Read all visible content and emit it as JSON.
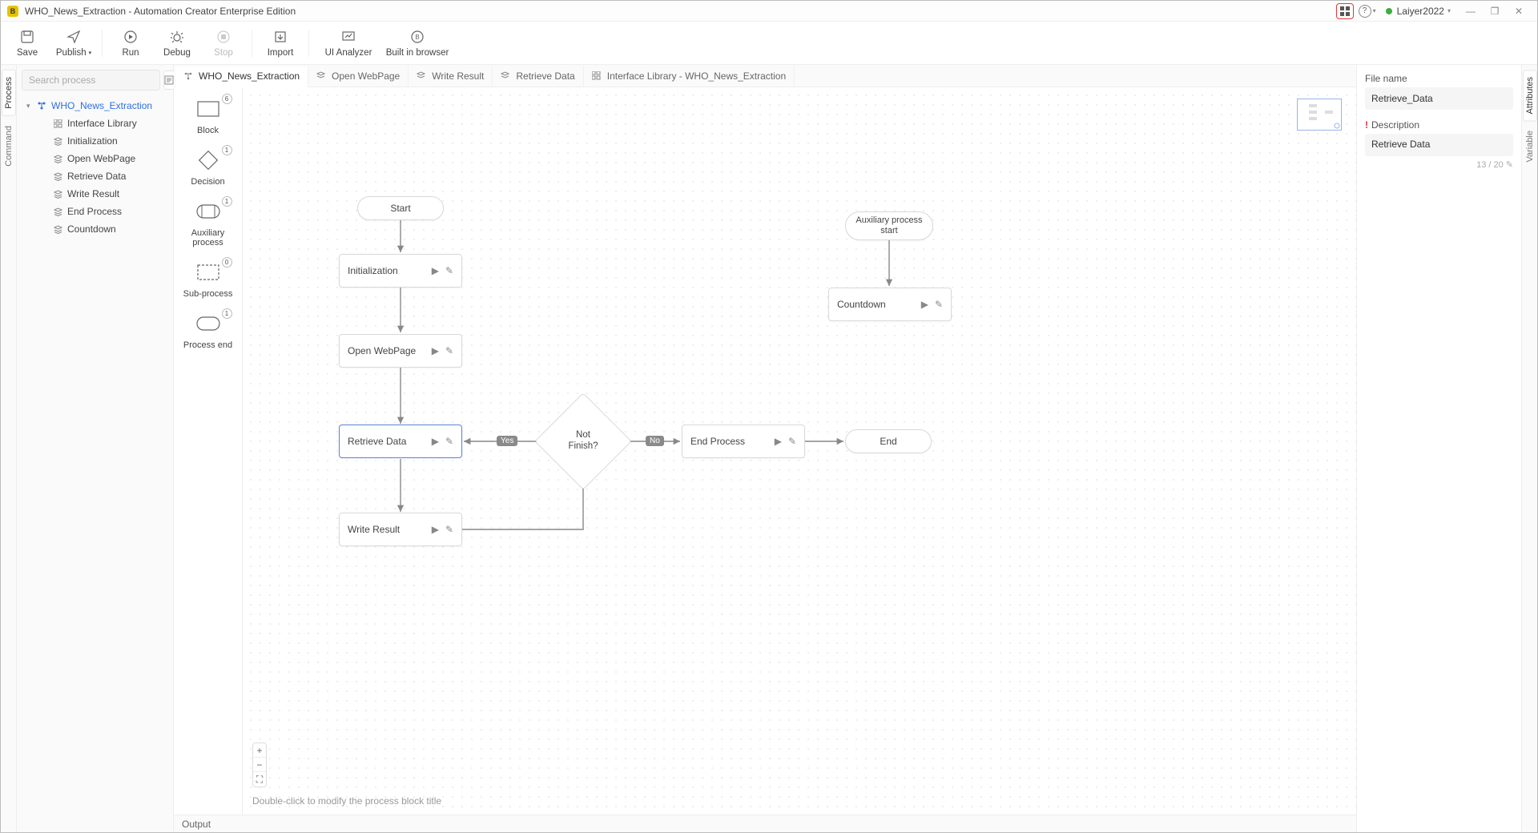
{
  "titlebar": {
    "app_icon_letter": "B",
    "title": "WHO_News_Extraction - Automation Creator Enterprise Edition",
    "user": "Laiyer2022"
  },
  "toolbar": {
    "save": "Save",
    "publish": "Publish",
    "run": "Run",
    "debug": "Debug",
    "stop": "Stop",
    "import": "Import",
    "ui_analyzer": "UI Analyzer",
    "built_in_browser": "Built in browser"
  },
  "side_tabs": {
    "process": "Process",
    "command": "Command"
  },
  "right_tabs": {
    "attributes": "Attributes",
    "variable": "Variable"
  },
  "search": {
    "placeholder": "Search process"
  },
  "tree": {
    "root": "WHO_News_Extraction",
    "children": [
      "Interface Library",
      "Initialization",
      "Open WebPage",
      "Retrieve Data",
      "Write Result",
      "End Process",
      "Countdown"
    ]
  },
  "palette": {
    "block": {
      "label": "Block",
      "badge": "6"
    },
    "decision": {
      "label": "Decision",
      "badge": "1"
    },
    "aux": {
      "label": "Auxiliary process",
      "badge": "1"
    },
    "sub": {
      "label": "Sub-process",
      "badge": "0"
    },
    "end": {
      "label": "Process end",
      "badge": "1"
    }
  },
  "tabs": [
    {
      "label": "WHO_News_Extraction",
      "icon": "flow",
      "active": true
    },
    {
      "label": "Open WebPage",
      "icon": "layers"
    },
    {
      "label": "Write Result",
      "icon": "layers"
    },
    {
      "label": "Retrieve Data",
      "icon": "layers"
    },
    {
      "label": "Interface Library - WHO_News_Extraction",
      "icon": "grid"
    }
  ],
  "canvas": {
    "hint": "Double-click to modify the process block title",
    "nodes": {
      "start": "Start",
      "init": "Initialization",
      "open": "Open WebPage",
      "retrieve": "Retrieve Data",
      "write": "Write Result",
      "decision": "Not\nFinish?",
      "endproc": "End Process",
      "end": "End",
      "aux_start": "Auxiliary process\nstart",
      "countdown": "Countdown"
    },
    "edge_labels": {
      "yes": "Yes",
      "no": "No"
    }
  },
  "attrs": {
    "filename_label": "File name",
    "filename_value": "Retrieve_Data",
    "desc_label": "Description",
    "desc_value": "Retrieve Data",
    "counter": "13 / 20"
  },
  "output": {
    "label": "Output"
  }
}
